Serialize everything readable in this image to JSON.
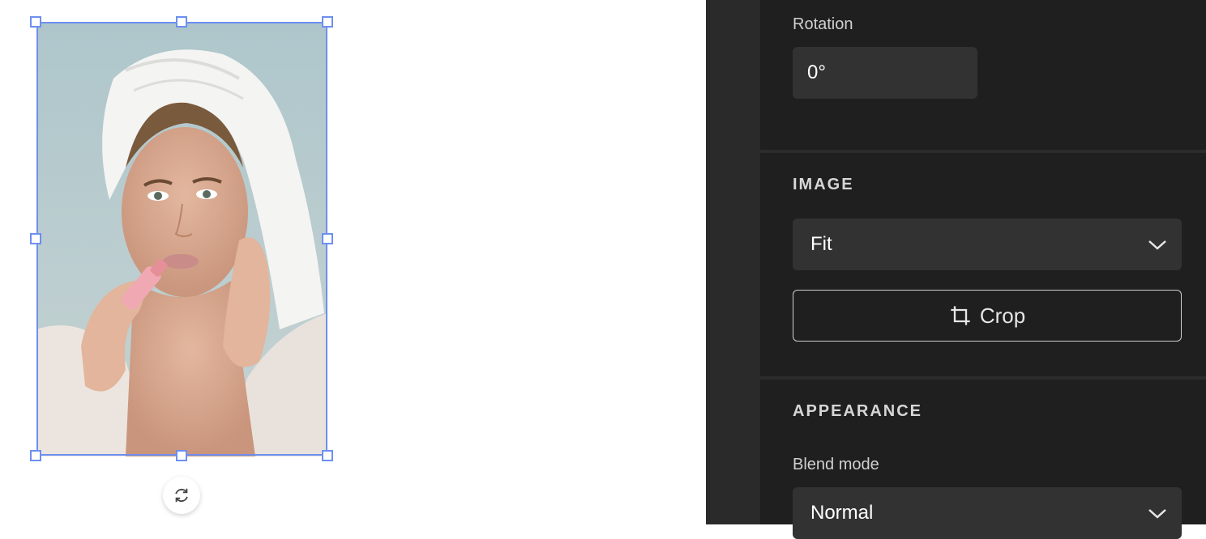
{
  "panel": {
    "rotation": {
      "label": "Rotation",
      "value": "0°"
    },
    "image_section": {
      "title": "IMAGE",
      "fit_select": "Fit",
      "crop_button": "Crop"
    },
    "appearance_section": {
      "title": "APPEARANCE",
      "blend_label": "Blend mode",
      "blend_select": "Normal"
    }
  },
  "canvas": {
    "selection_color": "#6d8ff0",
    "icons": [
      "rotate-icon"
    ]
  }
}
